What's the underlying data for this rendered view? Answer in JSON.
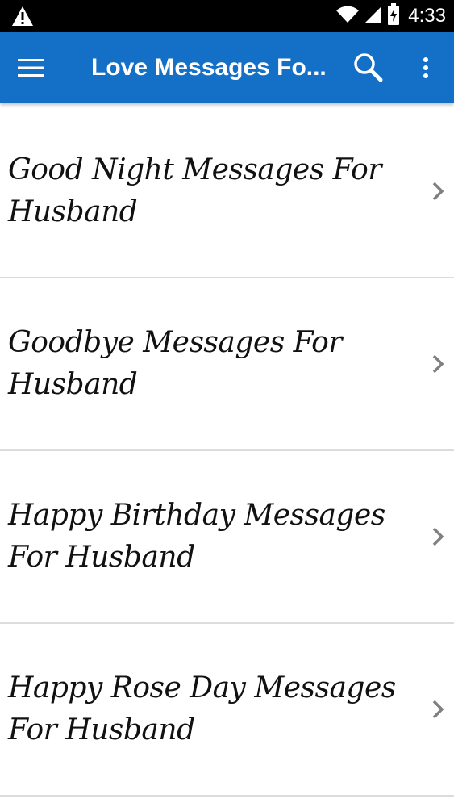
{
  "status_bar": {
    "time": "4:33",
    "icons": [
      "warning-icon",
      "wifi-icon",
      "signal-icon",
      "battery-icon"
    ]
  },
  "app_bar": {
    "title": "Love Messages Fo...",
    "menu_icon": "hamburger-menu-icon",
    "search_icon": "search-icon",
    "more_icon": "more-vert-icon",
    "color": "#1470c7"
  },
  "list": {
    "items": [
      {
        "label": "Good Night Messages For Husband"
      },
      {
        "label": "Goodbye Messages For Husband"
      },
      {
        "label": "Happy Birthday Messages For Husband"
      },
      {
        "label": "Happy Rose Day Messages For Husband"
      }
    ]
  }
}
